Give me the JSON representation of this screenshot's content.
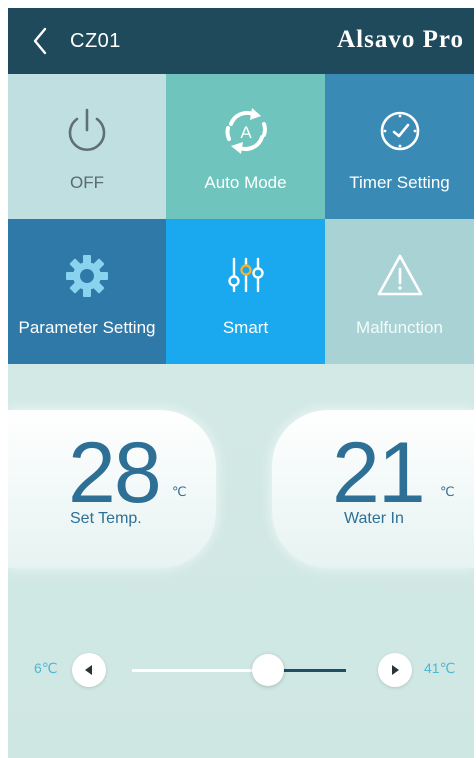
{
  "header": {
    "back_icon": "chevron-left-icon",
    "device_name": "CZ01",
    "brand": "Alsavo Pro"
  },
  "tiles": {
    "off": {
      "label": "OFF",
      "icon": "power-icon"
    },
    "auto_mode": {
      "label": "Auto Mode",
      "icon": "auto-mode-icon"
    },
    "timer": {
      "label": "Timer Setting",
      "icon": "clock-icon"
    },
    "parameter": {
      "label": "Parameter Setting",
      "icon": "gear-icon"
    },
    "smart": {
      "label": "Smart",
      "icon": "sliders-icon"
    },
    "malfunction": {
      "label": "Malfunction",
      "icon": "warning-icon"
    }
  },
  "set_temp": {
    "value": "28",
    "unit": "℃",
    "label": "Set Temp."
  },
  "water_in": {
    "value": "21",
    "unit": "℃",
    "label": "Water In"
  },
  "slider": {
    "min_label": "6℃",
    "max_label": "41℃",
    "min": 6,
    "max": 41,
    "value": 28
  },
  "colors": {
    "header": "#1e4a5c",
    "accent_blue": "#1aa8ee",
    "teal": "#6fc4bd",
    "temp_text": "#2e6f96"
  }
}
